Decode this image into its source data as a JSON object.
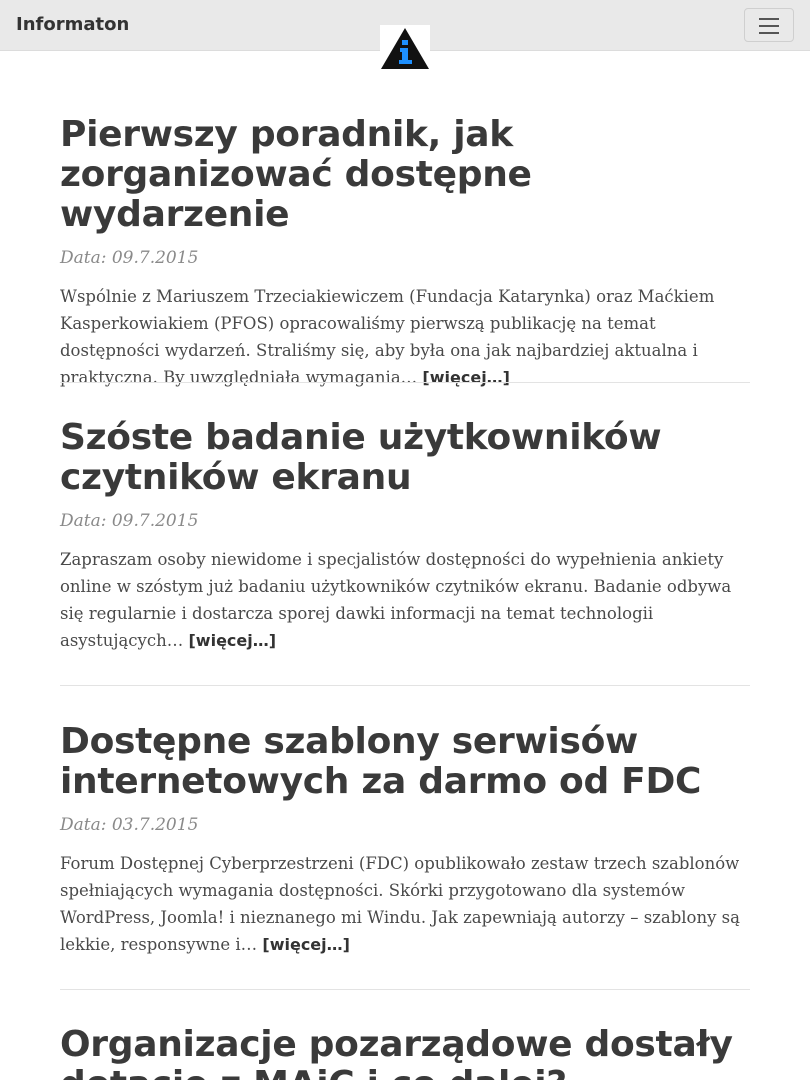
{
  "navbar": {
    "brand": "Informaton",
    "logo_icon": "informaton-info-triangle-icon",
    "menu_icon": "hamburger-menu-icon"
  },
  "articles": [
    {
      "title": "Pierwszy poradnik, jak zorganizować dostępne wydarzenie",
      "date": "Data: 09.7.2015",
      "excerpt": "Wspólnie z Mariuszem Trzeciakiewiczem (Fundacja Katarynka) oraz Maćkiem Kasperkowiakiem (PFOS) opracowaliśmy pierwszą publikację na temat dostępności wydarzeń. Straliśmy się, aby była ona jak najbardziej aktualna i praktyczna. By uwzględniała wymagania…",
      "more": "[więcej…]"
    },
    {
      "title": "Szóste badanie użytkowników czytników ekranu",
      "date": "Data: 09.7.2015",
      "excerpt": "Zapraszam osoby niewidome i specjalistów dostępności do wypełnienia ankiety online w szóstym już badaniu użytkowników czytników ekranu. Badanie odbywa się regularnie i dostarcza sporej dawki informacji na temat technologii asystujących…",
      "more": "[więcej…]"
    },
    {
      "title": "Dostępne szablony serwisów internetowych za darmo od FDC",
      "date": "Data: 03.7.2015",
      "excerpt": "Forum Dostępnej Cyberprzestrzeni (FDC) opublikowało zestaw trzech szablonów spełniających wymagania dostępności. Skórki przygotowano dla systemów WordPress, Joomla! i nieznanego mi Windu. Jak zapewniają autorzy – szablony są lekkie, responsywne i…",
      "more": "[więcej…]"
    },
    {
      "title": "Organizacje pozarządowe dostały dotacje z MAiC i co dalej?"
    }
  ],
  "colors": {
    "navbar_bg": "#e9e9e9",
    "text": "#3a3a3a",
    "date": "#8a8a8a",
    "logo_triangle": "#111111",
    "logo_symbol": "#1e90ff"
  }
}
